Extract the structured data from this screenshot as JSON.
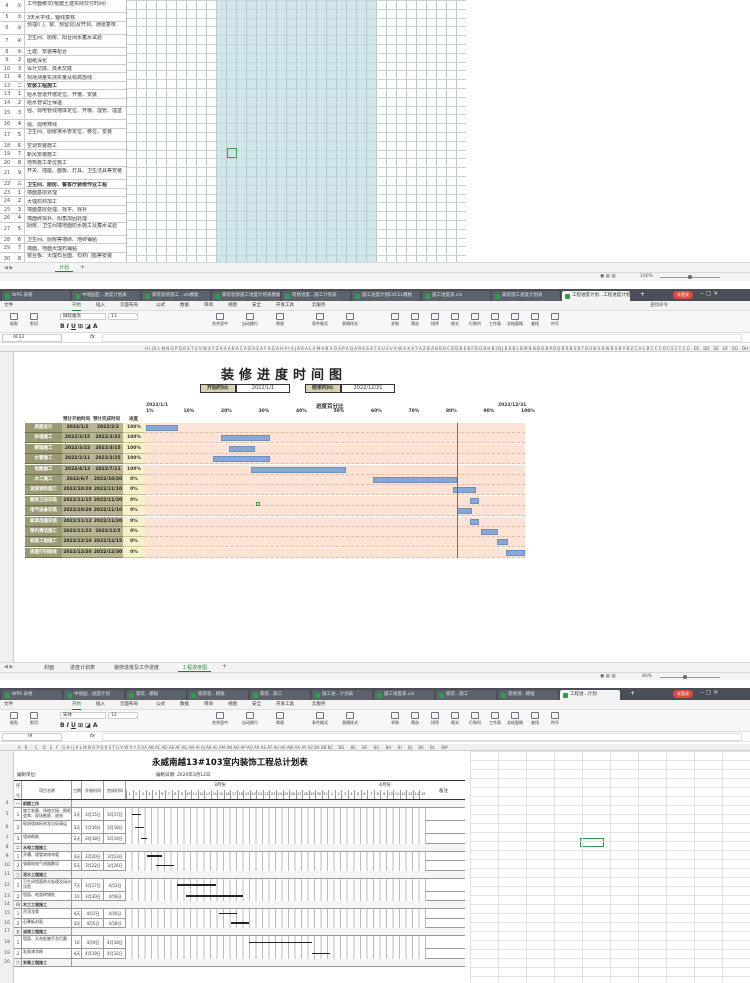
{
  "panel1": {
    "rows": [
      {
        "n": "4",
        "s": "①",
        "t": "工作面移交(根据土建实际交付时间)"
      },
      {
        "n": "5",
        "s": "②",
        "t": "3天水平线，轴线复核"
      },
      {
        "n": "6",
        "s": "③",
        "t": "预埋(门、窗、预留洞)及开洞、通道复核"
      },
      {
        "n": "7",
        "s": "④",
        "t": "卫生间、厨房、阳台闭水蓄水试验"
      },
      {
        "n": "8",
        "s": "⑤",
        "t": "土建、安装等配合"
      },
      {
        "n": "9",
        "s": "2",
        "t": "图纸深化"
      },
      {
        "n": "10",
        "s": "3",
        "t": "设计交底、技术交底"
      },
      {
        "n": "11",
        "s": "4",
        "t": "现场测量实测实量及标高放线"
      },
      {
        "n": "12",
        "s": "二",
        "t": "安装工程施工",
        "hd": true
      },
      {
        "n": "13",
        "s": "1",
        "t": "给水管道开槽定位、开槽、安装"
      },
      {
        "n": "14",
        "s": "2",
        "t": "给水管试压保温"
      },
      {
        "n": "15",
        "s": "3",
        "t": "强、弱电管线墙体定位、开槽、埋管、埋盒"
      },
      {
        "n": "16",
        "s": "4",
        "t": "强、弱电穿线"
      },
      {
        "n": "17",
        "s": "5",
        "t": "卫生间、厨房排水管定位、移位、安装"
      },
      {
        "n": "18",
        "s": "6",
        "t": "空调安装施工"
      },
      {
        "n": "19",
        "s": "7",
        "t": "新风安装施工"
      },
      {
        "n": "20",
        "s": "8",
        "t": "地热施工单位施工"
      },
      {
        "n": "21",
        "s": "9",
        "t": "开关、插座、面板、灯具、卫生洁具等安装"
      },
      {
        "n": "22",
        "s": "三",
        "t": "卫生间、厨房、餐客厅装修作业工程",
        "hd": true
      },
      {
        "n": "23",
        "s": "1",
        "t": "墙面基层处理"
      },
      {
        "n": "24",
        "s": "2",
        "t": "大理石材加工"
      },
      {
        "n": "25",
        "s": "3",
        "t": "墙面基层处理、找平、找补"
      },
      {
        "n": "26",
        "s": "4",
        "t": "墙面砖找补、阳角加固处理"
      },
      {
        "n": "27",
        "s": "5",
        "t": "厨房、卫生间墙地面防水施工及蓄水试验"
      },
      {
        "n": "28",
        "s": "6",
        "t": "卫生间、厨房等墙砖、地砖铺贴"
      },
      {
        "n": "29",
        "s": "7",
        "t": "墙面、地面大理石铺贴"
      },
      {
        "n": "30",
        "s": "8",
        "t": "窗台板、大理石台面、石材门槛等安装"
      }
    ],
    "tabs": [
      "计划"
    ],
    "zoom": "100%"
  },
  "panel2": {
    "tabs": [
      "WPS 表格",
      "中地园区...进度计划表",
      "家装装修施工...xls模板",
      "家装装修施工进度计划表模板",
      "装修进度...施工计划表",
      "施工进度计划EXCEL模板",
      "施工进度表.xls",
      "家装施工进度计划表",
      "工程进度计划...工程进度计划"
    ],
    "menu": [
      "文件",
      "开始",
      "插入",
      "页面布局",
      "公式",
      "数据",
      "审阅",
      "视图",
      "安全",
      "开发工具",
      "云服务"
    ],
    "active_menu": "开始",
    "ribbon": [
      "粘贴",
      "剪切",
      "复制",
      "格式刷",
      "合并居中",
      "自动换行",
      "常规",
      "条件格式",
      "表格样式",
      "求和",
      "筛选",
      "排序",
      "格式",
      "行和列",
      "工作表",
      "冻结窗格",
      "查找",
      "符号"
    ],
    "font_name": "微软雅黑",
    "font_size": "11",
    "cell_ref": "AF22",
    "fx": "fx",
    "search": "查找命令",
    "title": "装修进度时间图",
    "start_label": "开始时间:",
    "start_value": "2022/1/1",
    "end_label": "结束时间:",
    "end_value": "2022/12/31",
    "axis_left": "2022/1/1",
    "axis_title": "进度百分比",
    "axis_right": "2022/12/31",
    "pct_ticks": [
      "1%",
      "10%",
      "20%",
      "30%",
      "40%",
      "50%",
      "60%",
      "70%",
      "80%",
      "90%",
      "100%"
    ],
    "col_start": "预计开始时间",
    "col_end": "预计完成时间",
    "col_prog": "进度",
    "tasks": [
      {
        "name": "房屋设计",
        "start": "2022/1/2",
        "end": "2022/2/2",
        "prog": "100%",
        "s": 0.003,
        "e": 0.088
      },
      {
        "name": "拆墙施工",
        "start": "2022/3/15",
        "end": "2022/3/31",
        "prog": "100%",
        "s": 0.2,
        "e": 0.33
      },
      {
        "name": "砌墙施工",
        "start": "2022/3/22",
        "end": "2022/3/15",
        "prog": "100%",
        "s": 0.22,
        "e": 0.29
      },
      {
        "name": "水管施工",
        "start": "2022/2/11",
        "end": "2022/3/25",
        "prog": "100%",
        "s": 0.18,
        "e": 0.33
      },
      {
        "name": "电路施工",
        "start": "2022/4/12",
        "end": "2022/7/11",
        "prog": "100%",
        "s": 0.28,
        "e": 0.53
      },
      {
        "name": "木工施工",
        "start": "2022/6/7",
        "end": "2022/10/20",
        "prog": "0%",
        "s": 0.6,
        "e": 0.82
      },
      {
        "name": "油漆涂料施工",
        "start": "2022/10/20",
        "end": "2022/11/10",
        "prog": "0%",
        "s": 0.81,
        "e": 0.87
      },
      {
        "name": "厨房卫浴安装",
        "start": "2022/11/15",
        "end": "2022/11/20",
        "prog": "0%",
        "s": 0.855,
        "e": 0.88
      },
      {
        "name": "电气设备安装",
        "start": "2022/10/29",
        "end": "2022/11/10",
        "prog": "0%",
        "s": 0.82,
        "e": 0.86
      },
      {
        "name": "家具电器安装",
        "start": "2022/11/12",
        "end": "2022/11/20",
        "prog": "0%",
        "s": 0.855,
        "e": 0.88
      },
      {
        "name": "室内清洁施工",
        "start": "2022/11/22",
        "end": "2022/12/5",
        "prog": "0%",
        "s": 0.885,
        "e": 0.93
      },
      {
        "name": "软装工程施工",
        "start": "2022/12/10",
        "end": "2022/12/15",
        "prog": "0%",
        "s": 0.925,
        "e": 0.955
      },
      {
        "name": "房屋打扫验收",
        "start": "2022/12/20",
        "end": "2022/12/30",
        "prog": "0%",
        "s": 0.95,
        "e": 1.0
      }
    ],
    "today_frac": 0.82,
    "sheet_tabs": [
      "封面",
      "进度计划表",
      "装修进度及工作进度",
      "工程进度图"
    ],
    "active_sheet": "工程进度图",
    "zoom": "80%"
  },
  "panel3": {
    "tabs": [
      "WPS 表格",
      "中地园...进度计划",
      "家装...模板",
      "家装装...模板",
      "家装...施工",
      "施工进...计划表",
      "施工进度表.xls",
      "家装...施工",
      "装修进...模板",
      "工程进...计划"
    ],
    "menu": [
      "文件",
      "开始",
      "插入",
      "页面布局",
      "公式",
      "数据",
      "审阅",
      "视图",
      "安全",
      "开发工具",
      "云服务"
    ],
    "active_menu": "开始",
    "font_name": "宋体",
    "font_size": "12",
    "cell_ref": "I9",
    "title": "永威南越13#103室内装饰工程总计划表",
    "unit_label": "编制单位:",
    "date_label": "编制日期: 2020年3月12日",
    "month1": "3月份",
    "month2": "4月份",
    "h_seq": "序号",
    "h_name": "项目名称",
    "h_days": "工期",
    "h_start": "开始时间",
    "h_end": "完成时间",
    "h_note": "备注",
    "rows": [
      {
        "seq": "一",
        "name": "前期工作",
        "hd": true
      },
      {
        "seq": "1",
        "name": "施工准备、场地交接、图纸会审、现场勘察、放线",
        "days": "3天",
        "start": "3月15日",
        "end": "3月17日",
        "bs": 0.02,
        "be": 0.05
      },
      {
        "seq": "2",
        "name": "现场墙体拆除及垃圾清运",
        "days": "3天",
        "start": "3月16日",
        "end": "3月18日",
        "bs": 0.03,
        "be": 0.06
      },
      {
        "seq": "3",
        "name": "墙体砌筑",
        "days": "2天",
        "start": "3月18日",
        "end": "3月19日",
        "bs": 0.05,
        "be": 0.07
      },
      {
        "seq": "二",
        "name": "水电工程施工",
        "hd": true
      },
      {
        "seq": "1",
        "name": "开槽、埋管穿线布管",
        "days": "4天",
        "start": "3月20日",
        "end": "3月23日",
        "bs": 0.07,
        "be": 0.12
      },
      {
        "seq": "2",
        "name": "强弱电电气线路敷设",
        "days": "5天",
        "start": "3月22日",
        "end": "3月26日",
        "bs": 0.1,
        "be": 0.16
      },
      {
        "seq": "三",
        "name": "泥水工程施工",
        "hd": true
      },
      {
        "seq": "1",
        "name": "卫生间墙面防水处理及闭水试验",
        "days": "7天",
        "start": "3月27日",
        "end": "4月2日",
        "bs": 0.17,
        "be": 0.3
      },
      {
        "seq": "2",
        "name": "墙面、地面砖铺贴",
        "days": "10天",
        "start": "3月30日",
        "end": "4月8日",
        "bs": 0.2,
        "be": 0.39
      },
      {
        "seq": "四",
        "name": "木工工程施工",
        "hd": true
      },
      {
        "seq": "1",
        "name": "吊顶龙骨",
        "days": "4天",
        "start": "4月3日",
        "end": "4月6日",
        "bs": 0.31,
        "be": 0.37
      },
      {
        "seq": "2",
        "name": "石膏板封面",
        "days": "4天",
        "start": "4月5日",
        "end": "4月8日",
        "bs": 0.35,
        "be": 0.41
      },
      {
        "seq": "五",
        "name": "油漆工程施工",
        "hd": true
      },
      {
        "seq": "1",
        "name": "墙面、天花批腻子及打磨",
        "days": "10天",
        "start": "4月9日",
        "end": "4月18日",
        "bs": 0.41,
        "be": 0.62
      },
      {
        "seq": "2",
        "name": "乳胶漆涂刷",
        "days": "4天",
        "start": "4月19日",
        "end": "4月22日",
        "bs": 0.62,
        "be": 0.68
      },
      {
        "seq": "六",
        "name": "安装工程施工",
        "hd": true
      }
    ],
    "days_header": [
      "1",
      "2",
      "3",
      "4",
      "5",
      "6",
      "7",
      "8",
      "9",
      "10",
      "11",
      "12",
      "13",
      "14",
      "15",
      "16",
      "17",
      "18",
      "19",
      "20",
      "21",
      "22",
      "23",
      "24",
      "25",
      "26",
      "27",
      "28",
      "29",
      "30",
      "31",
      "1",
      "2",
      "3",
      "4",
      "5",
      "6",
      "7",
      "8",
      "9",
      "10",
      "11",
      "12",
      "13",
      "14",
      "15"
    ]
  }
}
